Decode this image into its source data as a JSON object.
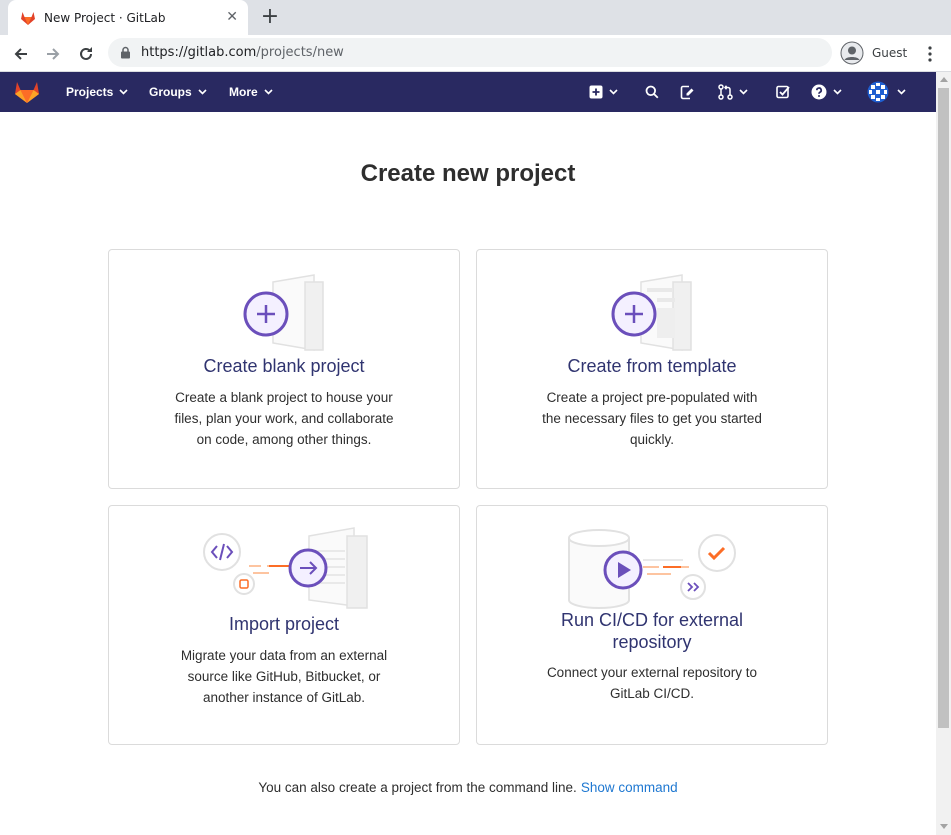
{
  "browser": {
    "tab_title": "New Project · GitLab",
    "url_host": "https://gitlab.com",
    "url_path": "/projects/new",
    "profile_label": "Guest"
  },
  "navbar": {
    "items": [
      {
        "label": "Projects"
      },
      {
        "label": "Groups"
      },
      {
        "label": "More"
      }
    ],
    "brand_color": "#292961"
  },
  "main": {
    "title": "Create new project",
    "cards": [
      {
        "title": "Create blank project",
        "description": "Create a blank project to house your files, plan your work, and collaborate on code, among other things."
      },
      {
        "title": "Create from template",
        "description": "Create a project pre-populated with the necessary files to get you started quickly."
      },
      {
        "title": "Import project",
        "description": "Migrate your data from an external source like GitHub, Bitbucket, or another instance of GitLab."
      },
      {
        "title": "Run CI/CD for external repository",
        "description": "Connect your external repository to GitLab CI/CD."
      }
    ],
    "footer_text": "You can also create a project from the command line.",
    "footer_link": "Show command"
  },
  "colors": {
    "accent_purple": "#6b4fbb",
    "title_color": "#303470",
    "link_color": "#1f78d1",
    "orange": "#fc6d26"
  }
}
